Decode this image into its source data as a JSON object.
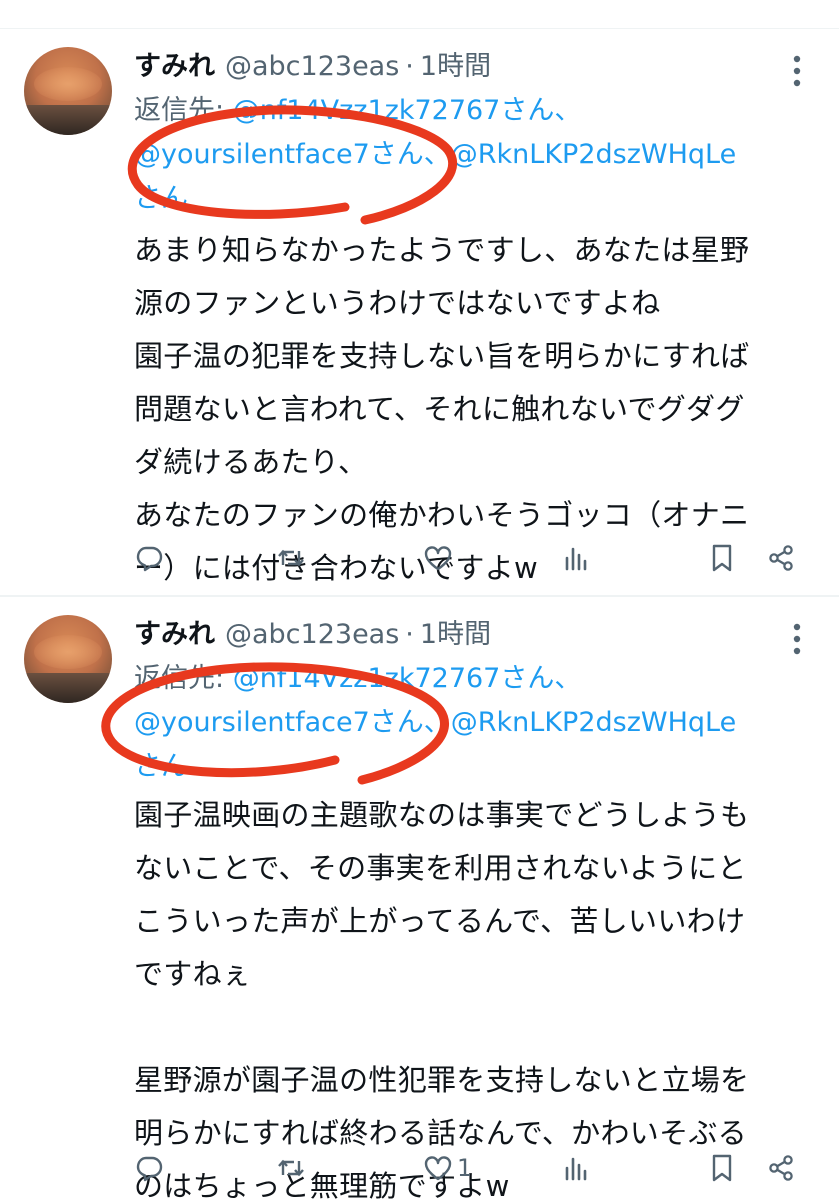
{
  "tweets": [
    {
      "author_name": "すみれ",
      "handle": "@abc123eas",
      "separator": "·",
      "time": "1時間",
      "reply_prefix": "返信先: ",
      "reply_mention_1": "@nf14Vzz1zk72767さん、",
      "reply_mention_2": "@yoursilentface7さん",
      "reply_sep": "、",
      "reply_mention_3": "@RknLKP2dszWHqLe",
      "reply_mention_3_suffix": "さん",
      "body_lines": [
        "あまり知らなかったようですし、あなたは星野",
        "源のファンというわけではないですよね",
        "園子温の犯罪を支持しない旨を明らかにすれば",
        "問題ないと言われて、それに触れないでグダグ",
        "ダ続けるあたり、",
        "あなたのファンの俺かわいそうゴッコ（オナニ",
        "ー）には付き合わないですよw"
      ],
      "like_count": "",
      "icons": [
        "reply-icon",
        "retweet-icon",
        "like-icon",
        "views-icon",
        "bookmark-icon",
        "share-icon"
      ]
    },
    {
      "author_name": "すみれ",
      "handle": "@abc123eas",
      "separator": "·",
      "time": "1時間",
      "reply_prefix": "返信先: ",
      "reply_mention_1": "@nf14Vzz1zk72767さん、",
      "reply_mention_2": "@yoursilentface7さん",
      "reply_sep": "、",
      "reply_mention_3": "@RknLKP2dszWHqLe",
      "reply_mention_3_suffix": "さん",
      "body_lines": [
        "園子温映画の主題歌なのは事実でどうしようも",
        "ないことで、その事実を利用されないようにと",
        "こういった声が上がってるんで、苦しいいわけ",
        "ですねぇ",
        "",
        "星野源が園子温の性犯罪を支持しないと立場を",
        "明らかにすれば終わる話なんで、かわいそぶる",
        "のはちょっと無理筋ですよw"
      ],
      "like_count": "1",
      "icons": [
        "reply-icon",
        "retweet-icon",
        "like-icon",
        "views-icon",
        "bookmark-icon",
        "share-icon"
      ]
    }
  ],
  "colors": {
    "text": "#0f1419",
    "secondary": "#536471",
    "link": "#1d9bf0",
    "scribble": "#e8391e",
    "divider": "#eff3f4"
  }
}
